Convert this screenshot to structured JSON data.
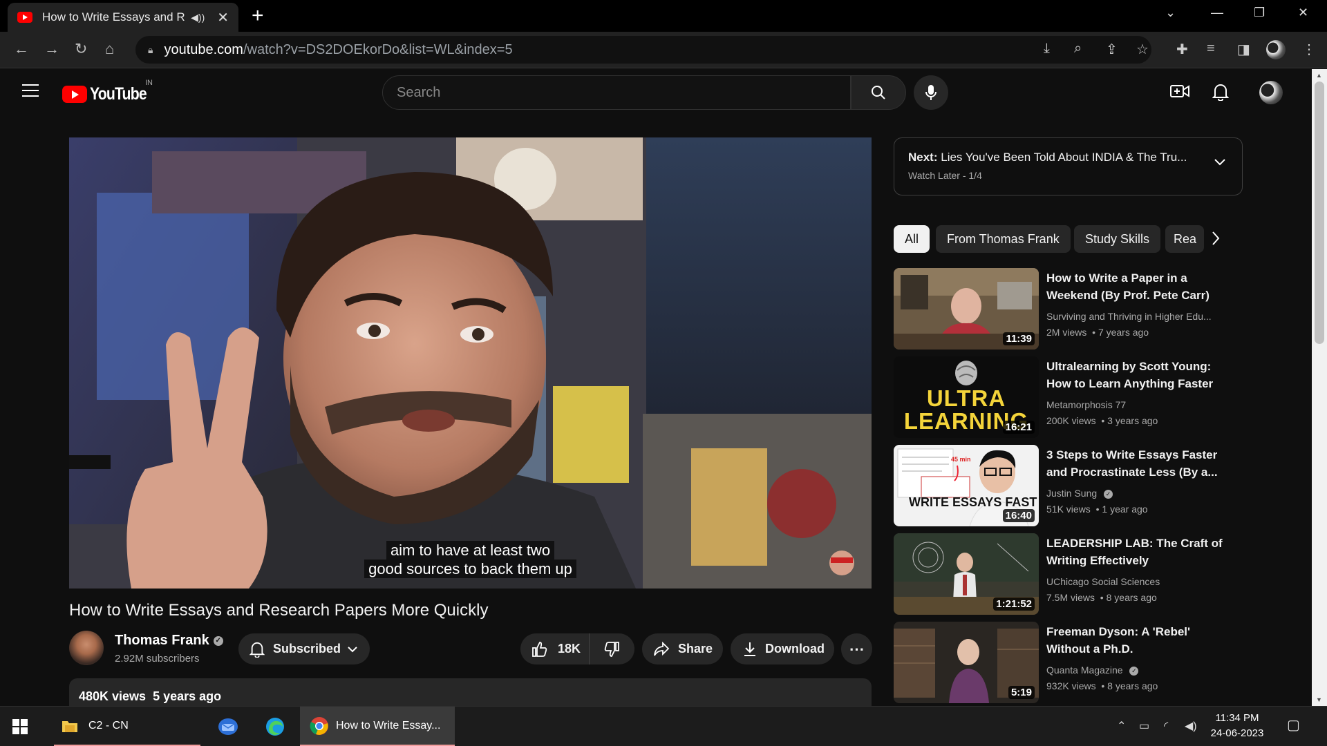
{
  "browser": {
    "tab_title": "How to Write Essays and Research Papers More Quickly",
    "url_host": "youtube.com",
    "url_path": "/watch?v=DS2DOEkorDo&list=WL&index=5"
  },
  "youtube": {
    "logo_text": "YouTube",
    "country_code": "IN",
    "search_placeholder": "Search"
  },
  "video": {
    "caption_line1": "aim to have at least two",
    "caption_line2": "good sources to back them up",
    "title": "How to Write Essays and Research Papers More Quickly",
    "channel_name": "Thomas Frank",
    "subscribers": "2.92M subscribers",
    "subscribe_label": "Subscribed",
    "likes": "18K",
    "share_label": "Share",
    "download_label": "Download",
    "views": "480K views",
    "age": "5 years ago"
  },
  "playlist_next": {
    "prefix": "Next:",
    "title": "Lies You've Been Told About INDIA & The Tru...",
    "subtitle": "Watch Later - 1/4"
  },
  "chips": [
    "All",
    "From Thomas Frank",
    "Study Skills",
    "Rea"
  ],
  "recommendations": [
    {
      "title": "How to Write a Paper in a Weekend (By Prof. Pete Carr)",
      "channel": "Surviving and Thriving in Higher Edu...",
      "views": "2M views",
      "age": "7 years ago",
      "duration": "11:39",
      "verified": false
    },
    {
      "title": "Ultralearning by Scott Young: How to Learn Anything Faster",
      "channel": "Metamorphosis 77",
      "views": "200K views",
      "age": "3 years ago",
      "duration": "16:21",
      "verified": false,
      "thumb_text": "ULTRA LEARNING"
    },
    {
      "title": "3 Steps to Write Essays Faster and Procrastinate Less (By a...",
      "channel": "Justin Sung",
      "views": "51K views",
      "age": "1 year ago",
      "duration": "16:40",
      "verified": true,
      "thumb_text": "WRITE ESSAYS FAST",
      "thumb_badge": "45 min"
    },
    {
      "title": "LEADERSHIP LAB: The Craft of Writing Effectively",
      "channel": "UChicago Social Sciences",
      "views": "7.5M views",
      "age": "8 years ago",
      "duration": "1:21:52",
      "verified": false
    },
    {
      "title": "Freeman Dyson: A 'Rebel' Without a Ph.D.",
      "channel": "Quanta Magazine",
      "views": "932K views",
      "age": "8 years ago",
      "duration": "5:19",
      "verified": true
    }
  ],
  "taskbar": {
    "folder_label": "C2 - CN",
    "chrome_label": "How to Write Essay...",
    "time": "11:34 PM",
    "date": "24-06-2023"
  },
  "colors": {
    "yt_red": "#ff0000",
    "background": "#0f0f0f",
    "surface": "#272727",
    "secondary_text": "#aaaaaa"
  }
}
